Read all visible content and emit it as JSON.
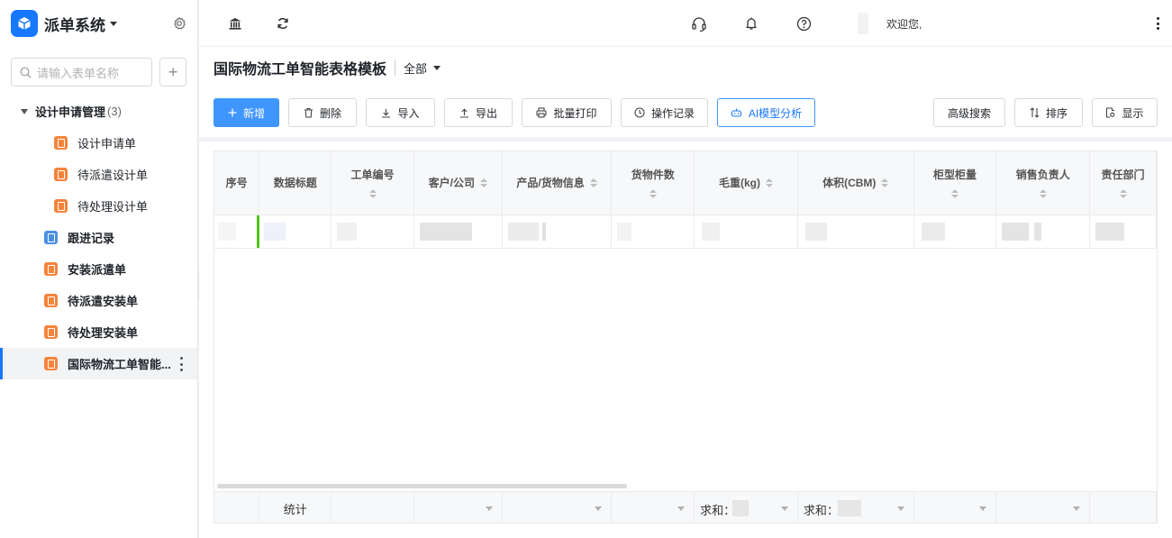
{
  "app": {
    "title": "派单系统"
  },
  "sidebar": {
    "search_placeholder": "请输入表单名称",
    "add_label": "+",
    "group": {
      "label": "设计申请管理",
      "count": "(3)"
    },
    "sub_items": [
      {
        "label": "设计申请单",
        "color": "#f5843b"
      },
      {
        "label": "待派遣设计单",
        "color": "#f5843b"
      },
      {
        "label": "待处理设计单",
        "color": "#f5843b"
      }
    ],
    "items": [
      {
        "label": "跟进记录",
        "color": "#4a90e2"
      },
      {
        "label": "安装派遣单",
        "color": "#f5843b"
      },
      {
        "label": "待派遣安装单",
        "color": "#f5843b"
      },
      {
        "label": "待处理安装单",
        "color": "#f5843b"
      },
      {
        "label": "国际物流工单智能...",
        "color": "#f5843b",
        "active": true
      }
    ]
  },
  "topbar": {
    "icons": [
      "bank-icon",
      "refresh-icon",
      "headset-icon",
      "bell-icon",
      "help-icon",
      "more-icon"
    ],
    "welcome": "欢迎您,"
  },
  "page": {
    "title": "国际物流工单智能表格模板",
    "view": "全部"
  },
  "toolbar": {
    "add": "新增",
    "delete": "删除",
    "import": "导入",
    "export": "导出",
    "batch_print": "批量打印",
    "op_log": "操作记录",
    "ai": "AI模型分析",
    "adv_search": "高级搜索",
    "sort": "排序",
    "display": "显示"
  },
  "table": {
    "columns": [
      "序号",
      "数据标题",
      "工单编号",
      "客户/公司",
      "产品/货物信息",
      "货物件数",
      "毛重(kg)",
      "体积(CBM)",
      "柜型柜量",
      "销售负责人",
      "责任部门"
    ],
    "footer": {
      "label": "统计",
      "sum1": "求和：",
      "sum2": "求和："
    }
  },
  "colors": {
    "accent": "#1677ff",
    "primary_button": "#4096ff",
    "row_marker": "#52c41a"
  }
}
